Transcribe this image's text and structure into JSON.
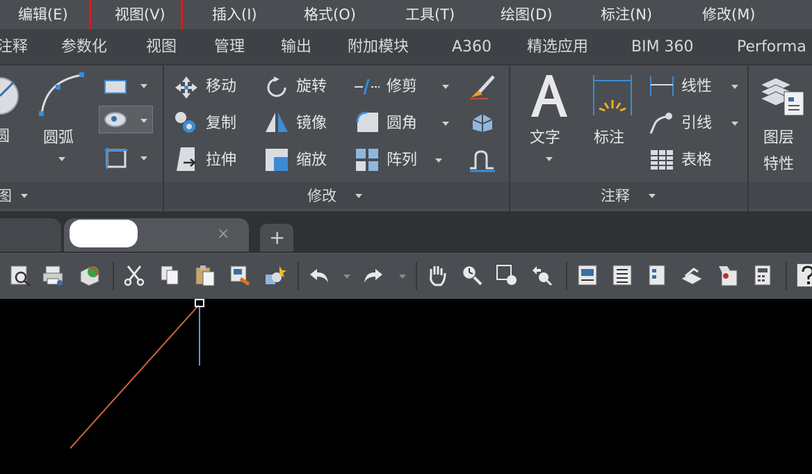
{
  "menubar": {
    "items": [
      "编辑(E)",
      "视图(V)",
      "插入(I)",
      "格式(O)",
      "工具(T)",
      "绘图(D)",
      "标注(N)",
      "修改(M)"
    ]
  },
  "ribbon_tabs": [
    "注释",
    "参数化",
    "视图",
    "管理",
    "输出",
    "附加模块",
    "A360",
    "精选应用",
    "BIM 360",
    "Performa"
  ],
  "ribbon": {
    "draw_panel": {
      "circle_label": "圆",
      "arc_label": "圆弧",
      "title": "图"
    },
    "modify_panel": {
      "title": "修改",
      "move": "移动",
      "rotate": "旋转",
      "trim": "修剪",
      "copy": "复制",
      "mirror": "镜像",
      "fillet": "圆角",
      "stretch": "拉伸",
      "scale": "缩放",
      "array": "阵列"
    },
    "annotation_panel": {
      "title": "注释",
      "text": "文字",
      "dimension": "标注",
      "linear": "线性",
      "leader": "引线",
      "table": "表格"
    },
    "layers_panel": {
      "layer_properties_1": "图层",
      "layer_properties_2": "特性"
    }
  },
  "filetabs": {
    "add_symbol": "+",
    "close_symbol": "×"
  },
  "colors": {
    "menubar_bg": "#4a4d52",
    "highlight": "#e0161b",
    "canvas_bg": "#000000",
    "line_orange": "#d0643c",
    "line_blue": "#6a94c8"
  }
}
